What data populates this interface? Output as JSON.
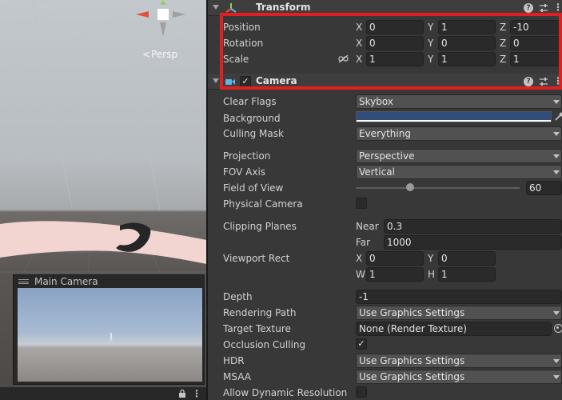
{
  "scene": {
    "persp_label": "Persp",
    "camera_preview_title": "Main Camera",
    "lock_glyph": "🔒",
    "menu_glyph": "⋮"
  },
  "transform": {
    "title": "Transform",
    "position": {
      "label": "Position",
      "x": "0",
      "y": "1",
      "z": "-10"
    },
    "rotation": {
      "label": "Rotation",
      "x": "0",
      "y": "0",
      "z": "0"
    },
    "scale": {
      "label": "Scale",
      "x": "1",
      "y": "1",
      "z": "1"
    },
    "axis_labels": {
      "x": "X",
      "y": "Y",
      "z": "Z"
    }
  },
  "camera": {
    "title": "Camera",
    "enabled": true,
    "clear_flags": {
      "label": "Clear Flags",
      "value": "Skybox"
    },
    "background": {
      "label": "Background",
      "color": "#314d79"
    },
    "culling_mask": {
      "label": "Culling Mask",
      "value": "Everything"
    },
    "projection": {
      "label": "Projection",
      "value": "Perspective"
    },
    "fov_axis": {
      "label": "FOV Axis",
      "value": "Vertical"
    },
    "field_of_view": {
      "label": "Field of View",
      "value": "60",
      "slider_fraction": 0.33
    },
    "physical_camera": {
      "label": "Physical Camera",
      "checked": false
    },
    "clipping_planes": {
      "label": "Clipping Planes",
      "near_label": "Near",
      "near": "0.3",
      "far_label": "Far",
      "far": "1000"
    },
    "viewport_rect": {
      "label": "Viewport Rect",
      "x_label": "X",
      "x": "0",
      "y_label": "Y",
      "y": "0",
      "w_label": "W",
      "w": "1",
      "h_label": "H",
      "h": "1"
    },
    "depth": {
      "label": "Depth",
      "value": "-1"
    },
    "rendering_path": {
      "label": "Rendering Path",
      "value": "Use Graphics Settings"
    },
    "target_texture": {
      "label": "Target Texture",
      "value": "None (Render Texture)"
    },
    "occlusion_culling": {
      "label": "Occlusion Culling",
      "checked": true
    },
    "hdr": {
      "label": "HDR",
      "value": "Use Graphics Settings"
    },
    "msaa": {
      "label": "MSAA",
      "value": "Use Graphics Settings"
    },
    "dynamic_resolution": {
      "label": "Allow Dynamic Resolution",
      "checked": false
    }
  },
  "icons": {
    "help": "?",
    "more": "⋮",
    "check": "✓"
  },
  "colors": {
    "highlight": "#e02020",
    "camera_icon": "#5fb6e6",
    "transform_icon": "#8fd05e"
  }
}
